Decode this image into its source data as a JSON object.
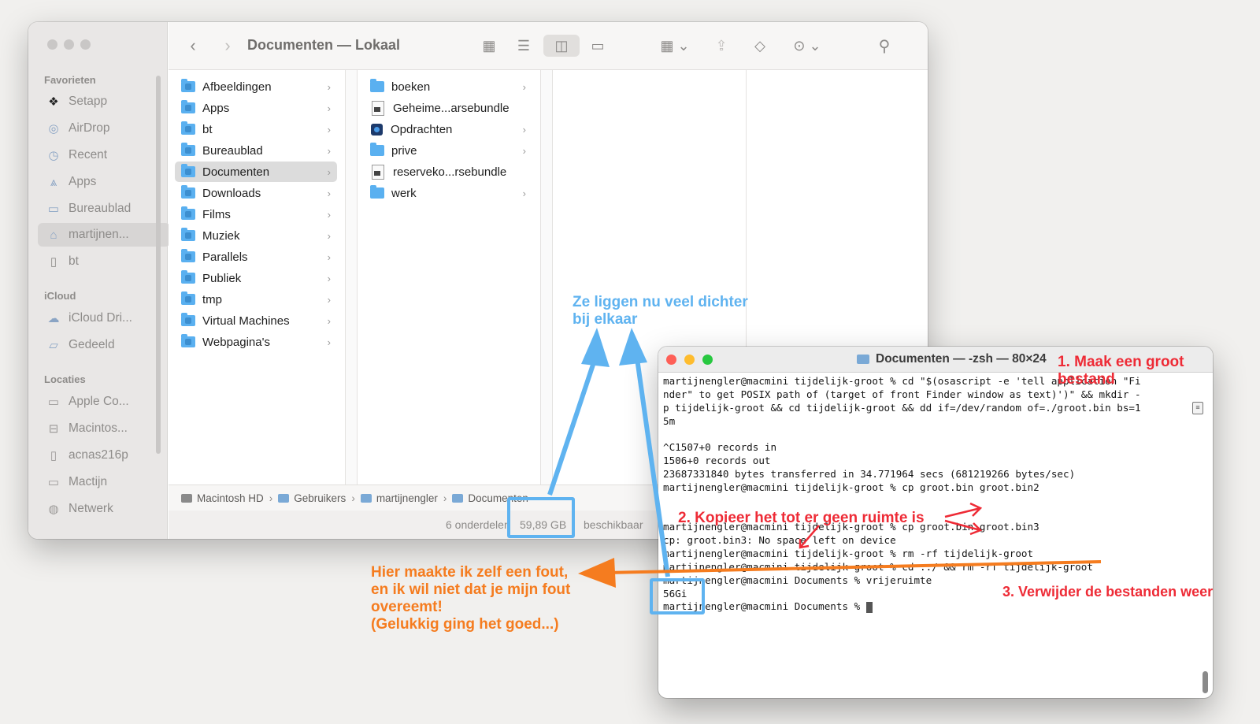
{
  "finder": {
    "title": "Documenten — Lokaal",
    "sidebar": {
      "sections": [
        "Favorieten",
        "iCloud",
        "Locaties"
      ],
      "favorites": [
        {
          "label": "Setapp",
          "icon": "setapp-icon"
        },
        {
          "label": "AirDrop",
          "icon": "airdrop-icon"
        },
        {
          "label": "Recent",
          "icon": "clock-icon"
        },
        {
          "label": "Apps",
          "icon": "apps-icon"
        },
        {
          "label": "Bureaublad",
          "icon": "desktop-icon"
        },
        {
          "label": "martijnen...",
          "icon": "home-icon"
        },
        {
          "label": "bt",
          "icon": "document-icon"
        }
      ],
      "icloud": [
        {
          "label": "iCloud Dri...",
          "icon": "cloud-icon"
        },
        {
          "label": "Gedeeld",
          "icon": "shared-folder-icon"
        }
      ],
      "locations": [
        {
          "label": "Apple Co...",
          "icon": "drive-icon"
        },
        {
          "label": "Macintos...",
          "icon": "drive-icon"
        },
        {
          "label": "acnas216p",
          "icon": "document-icon"
        },
        {
          "label": "Mactijn",
          "icon": "display-icon"
        },
        {
          "label": "Netwerk",
          "icon": "globe-icon"
        }
      ]
    },
    "column1": [
      {
        "label": "Afbeeldingen"
      },
      {
        "label": "Apps"
      },
      {
        "label": "bt"
      },
      {
        "label": "Bureaublad"
      },
      {
        "label": "Documenten",
        "selected": true
      },
      {
        "label": "Downloads"
      },
      {
        "label": "Films"
      },
      {
        "label": "Muziek"
      },
      {
        "label": "Parallels"
      },
      {
        "label": "Publiek"
      },
      {
        "label": "tmp"
      },
      {
        "label": "Virtual Machines"
      },
      {
        "label": "Webpagina's"
      }
    ],
    "column2": [
      {
        "label": "boeken",
        "kind": "folder"
      },
      {
        "label": "Geheime...arsebundle",
        "kind": "document"
      },
      {
        "label": "Opdrachten",
        "kind": "app"
      },
      {
        "label": "prive",
        "kind": "folder"
      },
      {
        "label": "reserveko...rsebundle",
        "kind": "document"
      },
      {
        "label": "werk",
        "kind": "folder"
      }
    ],
    "pathbar": [
      "Macintosh HD",
      "Gebruikers",
      "martijnengler",
      "Documenten"
    ],
    "status": {
      "items": "6 onderdelen",
      "free": "59,89 GB",
      "suffix": "beschikbaar"
    }
  },
  "terminal": {
    "title": "Documenten — -zsh — 80×24",
    "lines": [
      "martijnengler@macmini tijdelijk-groot % cd \"$(osascript -e 'tell application \"Fi",
      "nder\" to get POSIX path of (target of front Finder window as text)')\" && mkdir -",
      "p tijdelijk-groot && cd tijdelijk-groot && dd if=/dev/random of=./groot.bin bs=1",
      "5m",
      "",
      "^C1507+0 records in",
      "1506+0 records out",
      "23687331840 bytes transferred in 34.771964 secs (681219266 bytes/sec)",
      "martijnengler@macmini tijdelijk-groot % cp groot.bin groot.bin2",
      "",
      "",
      "martijnengler@macmini tijdelijk-groot % cp groot.bin groot.bin3",
      "cp: groot.bin3: No space left on device",
      "martijnengler@macmini tijdelijk-groot % rm -rf tijdelijk-groot",
      "martijnengler@macmini tijdelijk-groot % cd ../ && rm -rf tijdelijk-groot",
      "martijnengler@macmini Documents % vrijeruimte",
      "56Gi",
      "martijnengler@macmini Documents % "
    ]
  },
  "annotations": {
    "blue_note": "Ze liggen nu veel dichter\nbij elkaar",
    "step1": "1. Maak een groot\nbestand",
    "step2": "2. Kopieer het tot er geen ruimte is",
    "step3": "3. Verwijder de bestanden weer",
    "orange_note": "Hier maakte ik zelf een fout,\nen ik wil niet dat je mijn fout\novereemt!\n(Gelukkig ging het goed...)",
    "colors": {
      "blue": "#5fb3f0",
      "orange": "#f57c1f",
      "red": "#ee2b36"
    }
  }
}
